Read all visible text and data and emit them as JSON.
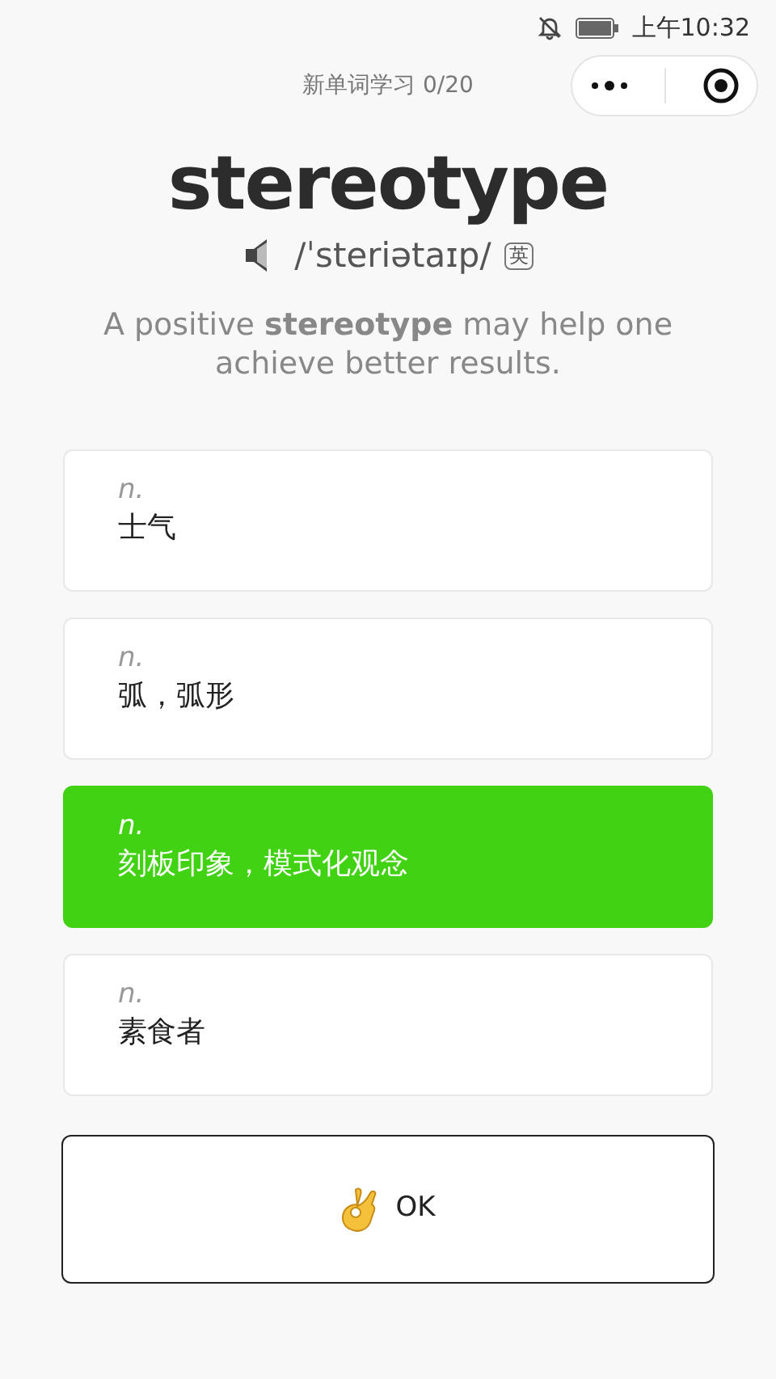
{
  "status_bar": {
    "time": "上午10:32"
  },
  "nav": {
    "title": "新单词学习 0/20"
  },
  "word": {
    "headword": "stereotype",
    "phonetic": "/ˈsteriətaɪp/",
    "accent_tag": "英"
  },
  "example": "A positive **stereotype** may help one achieve better results.",
  "options": [
    {
      "pos": "n.",
      "meaning": "士气",
      "selected": false
    },
    {
      "pos": "n.",
      "meaning": "弧，弧形",
      "selected": false
    },
    {
      "pos": "n.",
      "meaning": "刻板印象，模式化观念",
      "selected": true
    },
    {
      "pos": "n.",
      "meaning": "素食者",
      "selected": false
    }
  ],
  "confirm_button": {
    "label": "OK"
  }
}
